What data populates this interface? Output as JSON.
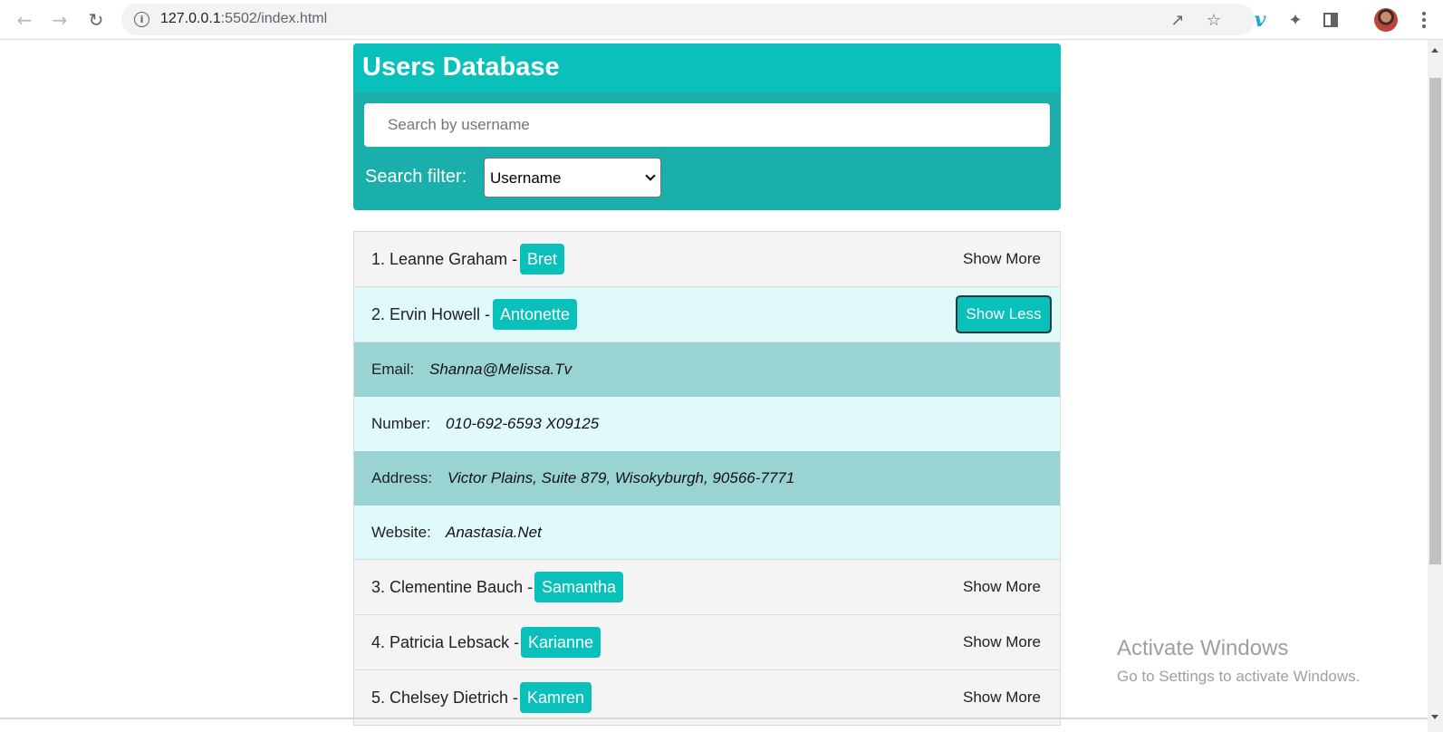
{
  "browser": {
    "url_host": "127.0.0.1",
    "url_rest": ":5502/index.html",
    "icons": [
      "back-icon",
      "forward-icon",
      "reload-icon",
      "site-info-icon",
      "share-icon",
      "bookmark-star-icon",
      "vimeo-extension-icon",
      "extensions-puzzle-icon",
      "side-panel-icon",
      "profile-avatar",
      "menu-kebab-icon"
    ]
  },
  "header": {
    "title": "Users Database",
    "search_placeholder": "Search by username",
    "filter_label": "Search filter:",
    "filter_value": "Username"
  },
  "users": [
    {
      "name": "1. Leanne Graham -",
      "username": "Bret",
      "toggle": "Show More"
    },
    {
      "name": "2. Ervin Howell -",
      "username": "Antonette",
      "toggle": "Show Less"
    },
    {
      "name": "3. Clementine Bauch -",
      "username": "Samantha",
      "toggle": "Show More"
    },
    {
      "name": "4. Patricia Lebsack -",
      "username": "Karianne",
      "toggle": "Show More"
    },
    {
      "name": "5. Chelsey Dietrich -",
      "username": "Kamren",
      "toggle": "Show More"
    }
  ],
  "details": {
    "email_label": "Email:",
    "email_value": "Shanna@Melissa.Tv",
    "number_label": "Number:",
    "number_value": "010-692-6593 X09125",
    "address_label": "Address:",
    "address_value": "Victor Plains, Suite 879, Wisokyburgh, 90566-7771",
    "website_label": "Website:",
    "website_value": "Anastasia.Net"
  },
  "watermark": {
    "title": "Activate Windows",
    "subtitle": "Go to Settings to activate Windows."
  },
  "colors": {
    "accent": "#0ac0bb",
    "header_bg": "#1aafab",
    "detail_dark": "#99d4d3",
    "detail_light": "#e0f9fa"
  }
}
